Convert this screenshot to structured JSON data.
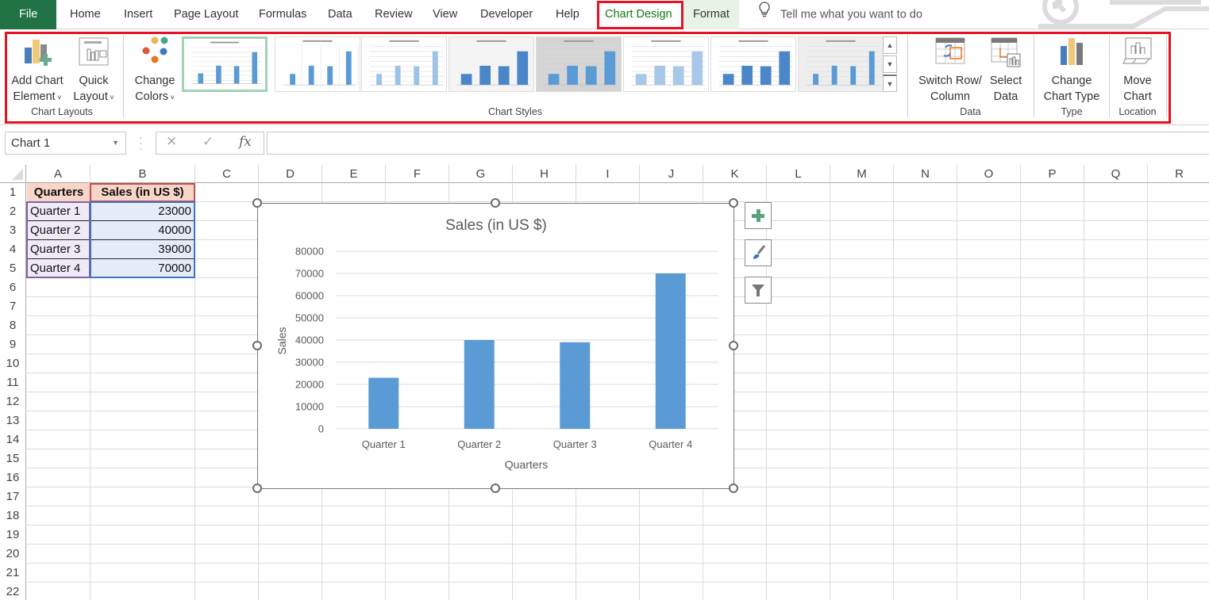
{
  "tabs": {
    "file": "File",
    "items": [
      "Home",
      "Insert",
      "Page Layout",
      "Formulas",
      "Data",
      "Review",
      "View",
      "Developer",
      "Help"
    ],
    "active": "Chart Design",
    "format": "Format",
    "tell_me": "Tell me what you want to do"
  },
  "ribbon": {
    "groups": {
      "chart_layouts": {
        "label": "Chart Layouts",
        "add_chart_element": [
          "Add Chart",
          "Element"
        ],
        "quick_layout": [
          "Quick",
          "Layout"
        ]
      },
      "chart_styles": {
        "label": "Chart Styles",
        "change_colors": [
          "Change",
          "Colors"
        ],
        "style_count": 8,
        "selected_style": 1
      },
      "data": {
        "label": "Data",
        "switch_row_column": [
          "Switch Row/",
          "Column"
        ],
        "select_data": [
          "Select",
          "Data"
        ]
      },
      "type": {
        "label": "Type",
        "change_chart_type": [
          "Change",
          "Chart Type"
        ]
      },
      "location": {
        "label": "Location",
        "move_chart": [
          "Move",
          "Chart"
        ]
      }
    },
    "gallery_scroll": {
      "up": "▲",
      "down": "▼",
      "more": "▼"
    }
  },
  "formula_bar": {
    "name_box": "Chart 1",
    "cancel_icon": "✕",
    "enter_icon": "✓",
    "fx_label": "fx",
    "value": ""
  },
  "sheet": {
    "columns": [
      "A",
      "B",
      "C",
      "D",
      "E",
      "F",
      "G",
      "H",
      "I",
      "J",
      "K",
      "L",
      "M",
      "N",
      "O",
      "P",
      "Q",
      "R"
    ],
    "rows": [
      "1",
      "2",
      "3",
      "4",
      "5",
      "6",
      "7",
      "8",
      "9",
      "10",
      "11",
      "12",
      "13",
      "14",
      "15",
      "16",
      "17",
      "18",
      "19",
      "20",
      "21",
      "22"
    ],
    "table": {
      "headers": [
        "Quarters",
        "Sales (in US $)"
      ],
      "rows": [
        [
          "Quarter 1",
          "23000"
        ],
        [
          "Quarter 2",
          "40000"
        ],
        [
          "Quarter 3",
          "39000"
        ],
        [
          "Quarter 4",
          "70000"
        ]
      ]
    }
  },
  "chart_side_buttons": [
    "chart-elements",
    "chart-styles",
    "chart-filters"
  ],
  "colors": {
    "accent_green": "#217346",
    "highlight_red": "#e81123",
    "bar": "#5b9bd5",
    "header_fill": "#f8d5c8"
  },
  "chart_data": {
    "type": "bar",
    "title": "Sales (in US $)",
    "xlabel": "Quarters",
    "ylabel": "Sales",
    "categories": [
      "Quarter 1",
      "Quarter 2",
      "Quarter 3",
      "Quarter 4"
    ],
    "values": [
      23000,
      40000,
      39000,
      70000
    ],
    "ylim": [
      0,
      80000
    ],
    "yticks": [
      "0",
      "10000",
      "20000",
      "30000",
      "40000",
      "50000",
      "60000",
      "70000",
      "80000"
    ],
    "grid": true,
    "legend": "none"
  }
}
